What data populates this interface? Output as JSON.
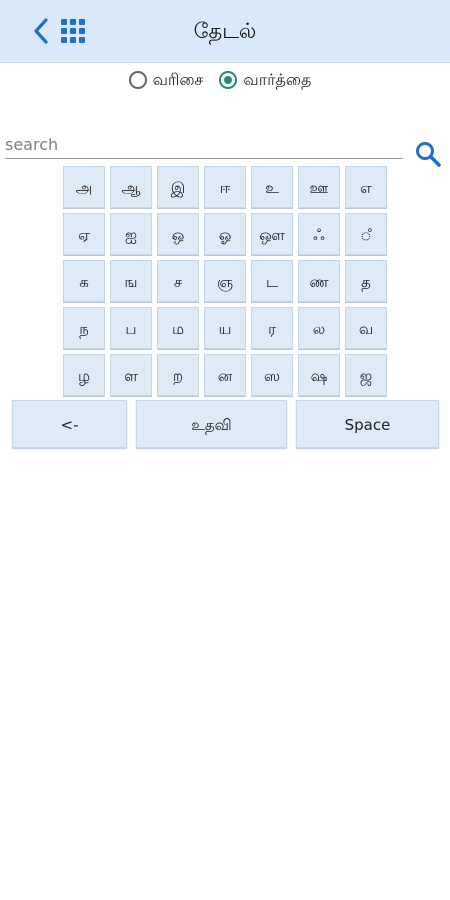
{
  "header": {
    "title": "தேடல்",
    "back_icon": "chevron-left-icon",
    "menu_icon": "grid-icon",
    "accent": "#1e6fd0",
    "background": "#d9e9fb"
  },
  "mode": {
    "options": [
      {
        "label": "வரிசை",
        "checked": false
      },
      {
        "label": "வார்த்தை",
        "checked": true
      }
    ],
    "checked_color": "#1f8a7a"
  },
  "search": {
    "placeholder": "search",
    "value": "",
    "icon": "search-icon"
  },
  "keyboard": {
    "rows": [
      [
        "அ",
        "ஆ",
        "இ",
        "ஈ",
        "உ",
        "ஊ",
        "எ"
      ],
      [
        "ஏ",
        "ஐ",
        "ஒ",
        "ஓ",
        "ஔ",
        "ஃ",
        "ஂ"
      ],
      [
        "க",
        "ங",
        "ச",
        "ஞ",
        "ட",
        "ண",
        "த"
      ],
      [
        "ந",
        "ப",
        "ம",
        "ய",
        "ர",
        "ல",
        "வ"
      ],
      [
        "ழ",
        "ள",
        "ற",
        "ன",
        "ஸ",
        "ஷ",
        "ஜ"
      ]
    ],
    "backspace_label": "<-",
    "help_label": "உதவி",
    "space_label": "Space",
    "key_color": "#dfeaf7"
  }
}
